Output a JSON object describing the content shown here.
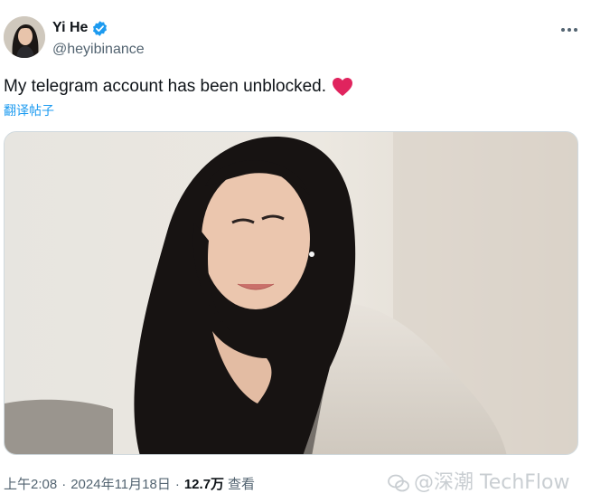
{
  "author": {
    "display_name": "Yi He",
    "handle": "@heyibinance",
    "verified": true
  },
  "tweet": {
    "text": "My telegram account has been unblocked.",
    "emoji": "heart-icon",
    "translate_label": "翻译帖子"
  },
  "meta": {
    "time": "上午2:08",
    "separator": "·",
    "date": "2024年11月18日",
    "views_count": "12.7万",
    "views_label": "查看"
  },
  "watermark": {
    "text": "@深潮 TechFlow"
  },
  "colors": {
    "verified_blue": "#1d9bf0",
    "link_blue": "#1d9bf0",
    "heart_red": "#e0245e",
    "secondary_text": "#536471"
  }
}
